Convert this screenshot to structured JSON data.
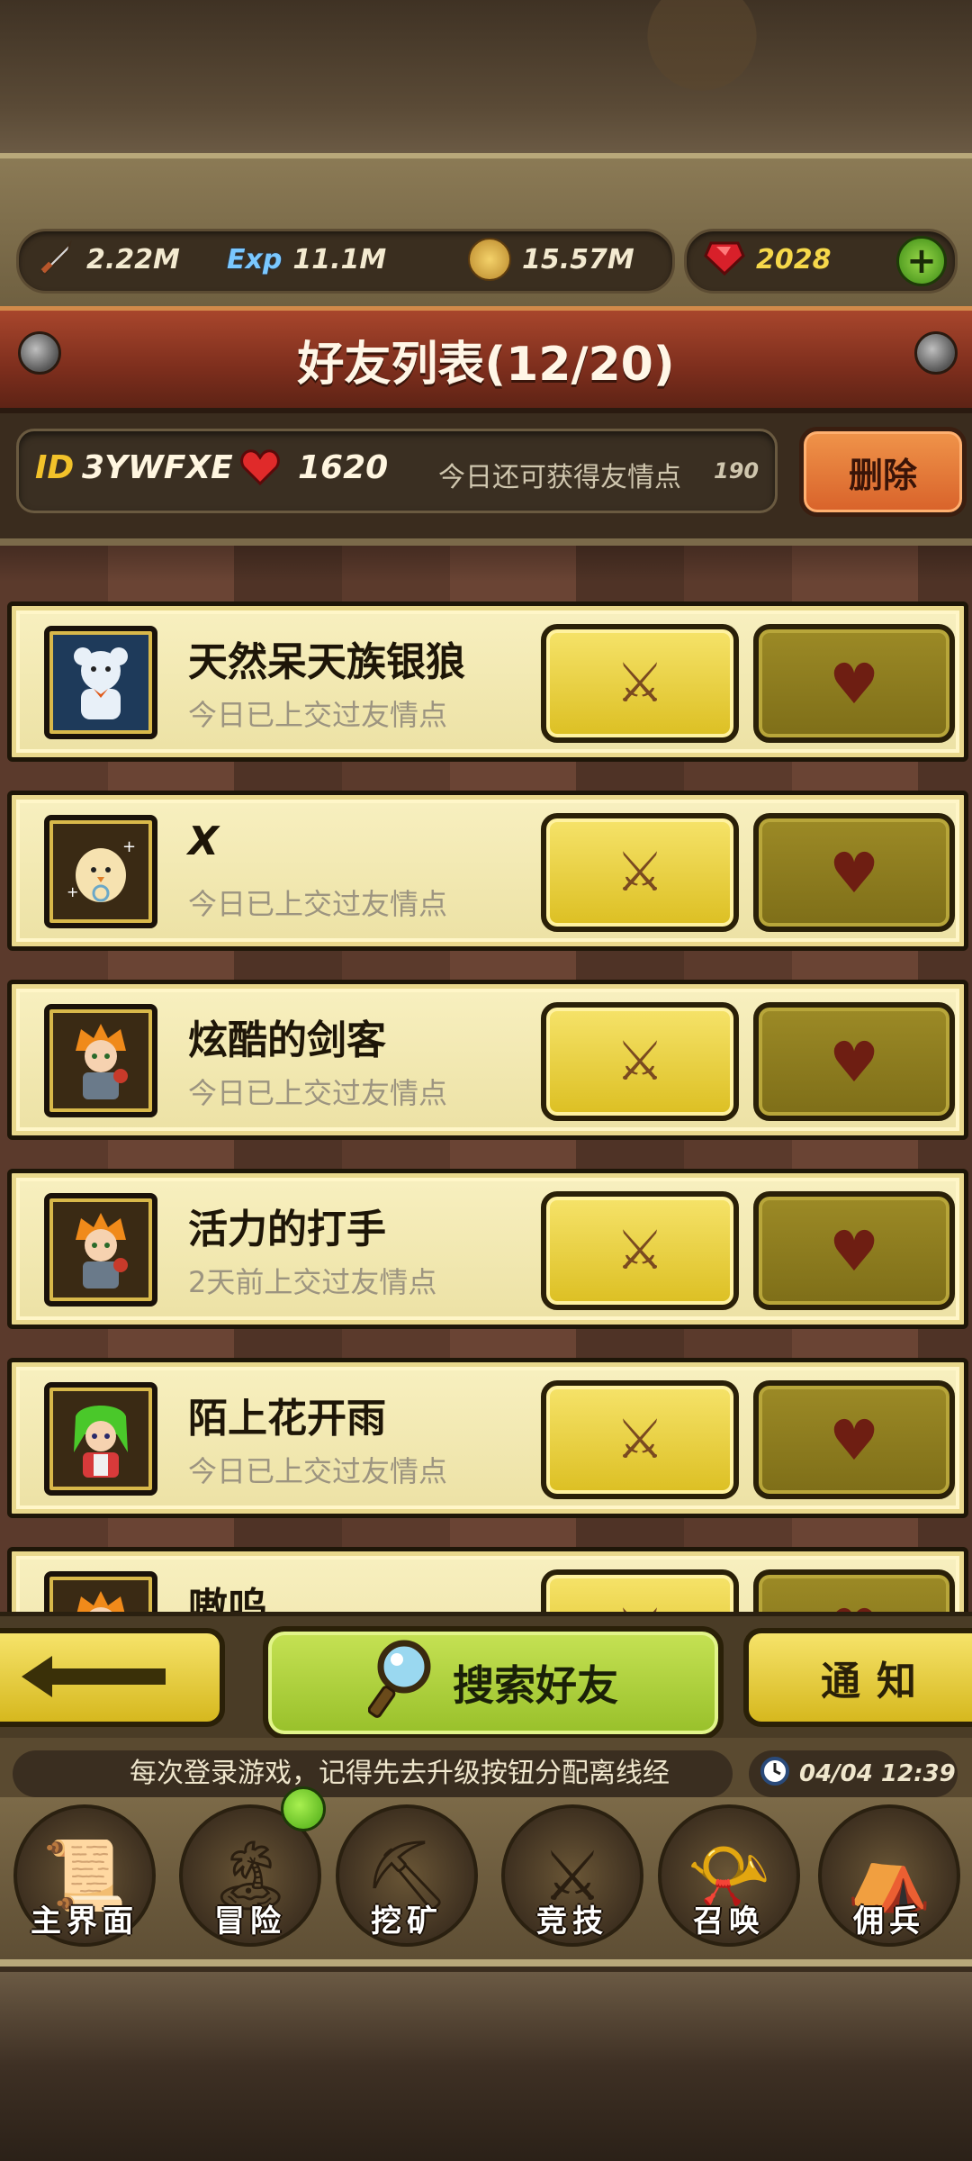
{
  "resources": {
    "attack": "2.22M",
    "exp": "11.1M",
    "gold": "15.57M",
    "gems": "2028",
    "exp_icon_text": "Exp"
  },
  "title": "好友列表(12/20)",
  "info": {
    "id_label": "ID",
    "id_value": "3YWFXE",
    "hearts": "1620",
    "friendship_text": "今日还可获得友情点",
    "friendship_value": "190",
    "delete_label": "删除"
  },
  "friends": [
    {
      "name": "天然呆天族银狼",
      "status": "今日已上交过友情点"
    },
    {
      "name": "X",
      "status": "今日已上交过友情点"
    },
    {
      "name": "炫酷的剑客",
      "status": "今日已上交过友情点"
    },
    {
      "name": "活力的打手",
      "status": "2天前上交过友情点"
    },
    {
      "name": "陌上花开雨",
      "status": "今日已上交过友情点"
    },
    {
      "name": "嗷呜",
      "status": ""
    }
  ],
  "actions": {
    "search_label": "搜索好友",
    "notice_label": "通知"
  },
  "ticker": {
    "text": "每次登录游戏，记得先去升级按钮分配离线经",
    "time": "04/04 12:39"
  },
  "nav": [
    {
      "label": "主界面",
      "icon": "scroll-map-icon"
    },
    {
      "label": "冒险",
      "icon": "island-icon"
    },
    {
      "label": "挖矿",
      "icon": "pickaxe-icon"
    },
    {
      "label": "竞技",
      "icon": "crossed-swords-icon"
    },
    {
      "label": "召唤",
      "icon": "summon-scroll-icon"
    },
    {
      "label": "佣兵",
      "icon": "tent-icon"
    }
  ],
  "colors": {
    "accent_yellow": "#f6e36a",
    "accent_green": "#c6e254",
    "banner_red": "#a8462c",
    "delete_orange": "#f0944a"
  }
}
